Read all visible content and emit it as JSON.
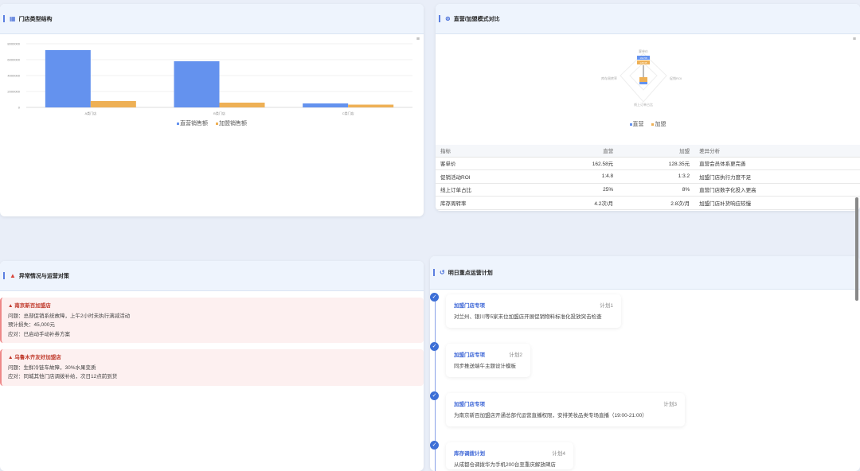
{
  "store_structure": {
    "title": "门店类型结构",
    "icon": "store-icon",
    "menu_icon": "hamburger-icon"
  },
  "chart_data": {
    "type": "bar",
    "categories": [
      "A类门店",
      "B类门店",
      "C类门店"
    ],
    "series": [
      {
        "name": "直营销售额",
        "color": "#6492ee",
        "values": [
          7200000,
          5800000,
          500000
        ]
      },
      {
        "name": "加盟销售额",
        "color": "#eeb055",
        "values": [
          800000,
          600000,
          350000
        ]
      }
    ],
    "ylim": [
      0,
      8000000
    ],
    "yticks": [
      "0",
      "2000000",
      "4000000",
      "6000000",
      "8000000"
    ],
    "legend": "bottom"
  },
  "compare": {
    "title": "直营/加盟模式对比",
    "icon": "compare-icon",
    "radar": {
      "indicators": [
        "客单价",
        "促销ROI",
        "线上订单占比",
        "库存周转率"
      ],
      "legend": [
        "直营",
        "加盟"
      ],
      "labels": [
        "162.58",
        "128.35"
      ]
    },
    "headers": [
      "指标",
      "直营",
      "加盟",
      "差异分析"
    ],
    "rows": [
      [
        "客单价",
        "162.58元",
        "128.35元",
        "直营会员体系更完善"
      ],
      [
        "促销活动ROI",
        "1:4.8",
        "1:3.2",
        "加盟门店执行力度不足"
      ],
      [
        "线上订单占比",
        "25%",
        "8%",
        "直营门店数字化投入更高"
      ],
      [
        "库存周转率",
        "4.2次/月",
        "2.8次/月",
        "加盟门店补货响应较慢"
      ]
    ]
  },
  "alerts": {
    "title": "异常情况与运营对策",
    "items": [
      {
        "store": "南京新百加盟店",
        "lines": [
          "问题：总部促销系统故障，上午2小时未执行满减活动",
          "预计损失：45,000元",
          "应对：已启动手动补券方案"
        ]
      },
      {
        "store": "乌鲁木齐友好加盟店",
        "lines": [
          "问题：生鲜冷链车故障，30%水果变质",
          "应对：同城其他门店调拨补给，次日12点前到货"
        ]
      }
    ]
  },
  "plans": {
    "title": "明日重点运营计划",
    "items": [
      {
        "title": "加盟门店专项",
        "tag": "计划1",
        "desc": "对兰州、银川等5家末位加盟店开展促销物料标准化投放突击检查"
      },
      {
        "title": "加盟门店专项",
        "tag": "计划2",
        "desc": "同步推送端午主题设计模板"
      },
      {
        "title": "加盟门店专项",
        "tag": "计划3",
        "desc": "为南京新百加盟店开通总部代运营直播权限，安排美妆品类专场直播（19:00-21:00）"
      },
      {
        "title": "库存调拨计划",
        "tag": "计划4",
        "desc": "从成都仓调拨华为手机200台至重庆解放碑店"
      }
    ]
  }
}
